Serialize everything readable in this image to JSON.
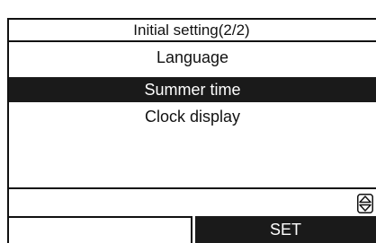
{
  "header": {
    "title": "Initial setting(2/2)"
  },
  "menu": {
    "items": [
      {
        "label": "Language",
        "selected": false
      },
      {
        "label": "Summer time",
        "selected": true
      },
      {
        "label": "Clock display",
        "selected": false
      }
    ]
  },
  "scroll": {
    "icon": "up-down-arrows-icon"
  },
  "softkeys": {
    "left_label": "",
    "right_label": "SET"
  },
  "colors": {
    "foreground": "#111111",
    "background": "#ffffff",
    "highlight": "#1a1a1a",
    "highlight_text": "#ffffff"
  }
}
